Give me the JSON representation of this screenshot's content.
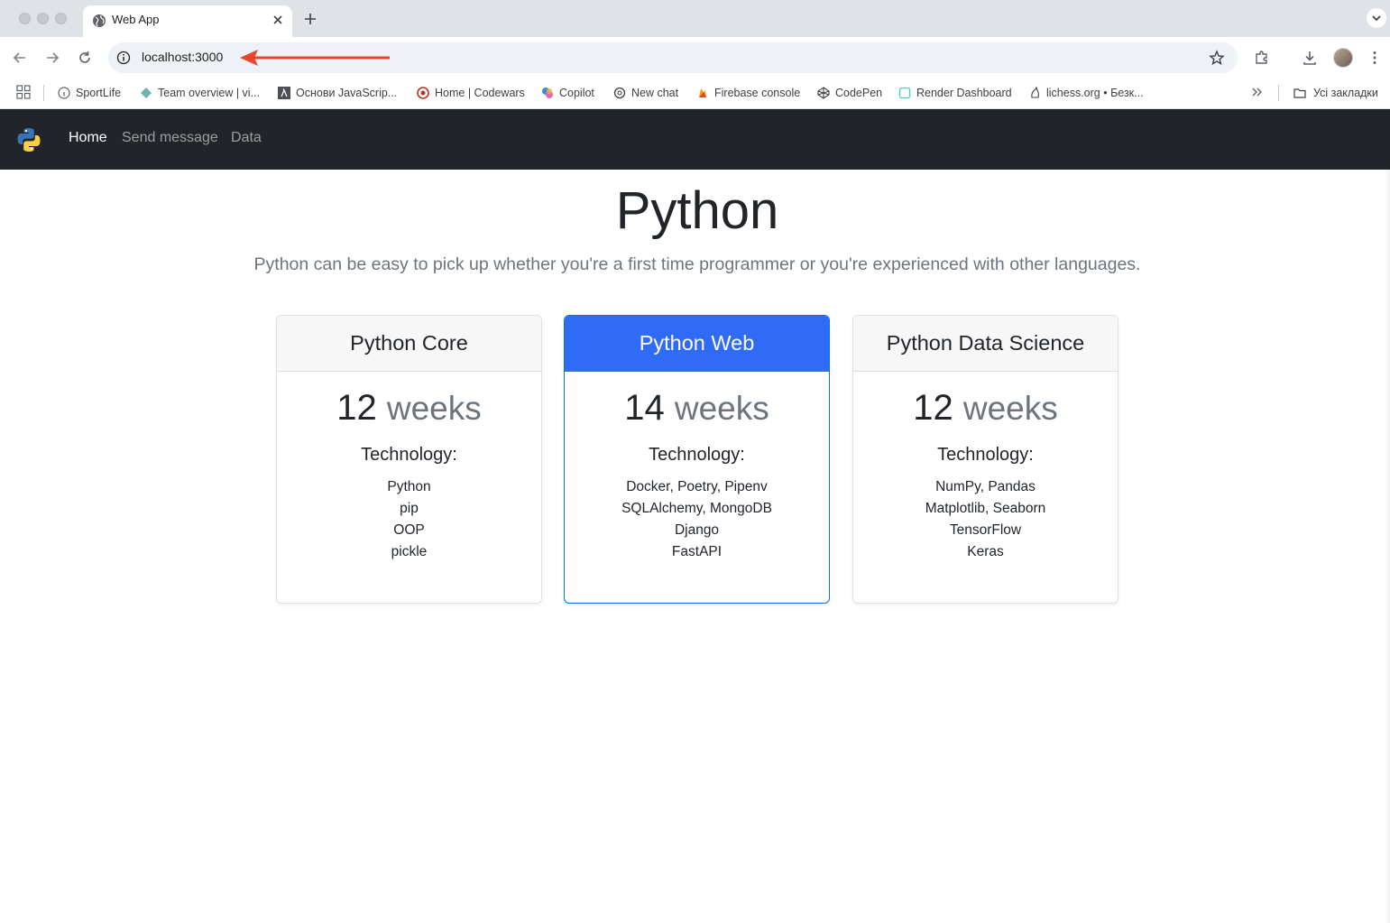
{
  "browser": {
    "tab_title": "Web App",
    "url": "localhost:3000",
    "bookmarks": [
      {
        "label": "SportLife",
        "icon": "info-circle-icon"
      },
      {
        "label": "Team overview | vi...",
        "icon": "diamond-icon"
      },
      {
        "label": "Основи JavaScrip...",
        "icon": "lambda-icon"
      },
      {
        "label": "Home | Codewars",
        "icon": "codewars-icon"
      },
      {
        "label": "Copilot",
        "icon": "copilot-icon"
      },
      {
        "label": "New chat",
        "icon": "openai-icon"
      },
      {
        "label": "Firebase console",
        "icon": "flame-icon"
      },
      {
        "label": "CodePen",
        "icon": "codepen-icon"
      },
      {
        "label": "Render Dashboard",
        "icon": "render-icon"
      },
      {
        "label": "lichess.org • Безк...",
        "icon": "lichess-icon"
      }
    ],
    "all_bookmarks_label": "Усі закладки",
    "accent_color": "#e8462c"
  },
  "site": {
    "nav": {
      "brand_icon": "python-logo-icon",
      "links": [
        "Home",
        "Send message",
        "Data"
      ],
      "active": "Home"
    },
    "hero": {
      "title": "Python",
      "lead": "Python can be easy to pick up whether you're a first time programmer or you're experienced with other languages."
    },
    "cards": [
      {
        "title": "Python Core",
        "duration": "12",
        "unit": "weeks",
        "tech_label": "Technology:",
        "items": [
          "Python",
          "pip",
          "OOP",
          "pickle"
        ],
        "featured": false
      },
      {
        "title": "Python Web",
        "duration": "14",
        "unit": "weeks",
        "tech_label": "Technology:",
        "items": [
          "Docker, Poetry, Pipenv",
          "SQLAlchemy, MongoDB",
          "Django",
          "FastAPI"
        ],
        "featured": true
      },
      {
        "title": "Python Data Science",
        "duration": "12",
        "unit": "weeks",
        "tech_label": "Technology:",
        "items": [
          "NumPy, Pandas",
          "Matplotlib, Seaborn",
          "TensorFlow",
          "Keras"
        ],
        "featured": false
      }
    ],
    "colors": {
      "navbar": "#212529",
      "featured_header": "#2f6bf5",
      "muted_text": "#6c757d"
    }
  }
}
